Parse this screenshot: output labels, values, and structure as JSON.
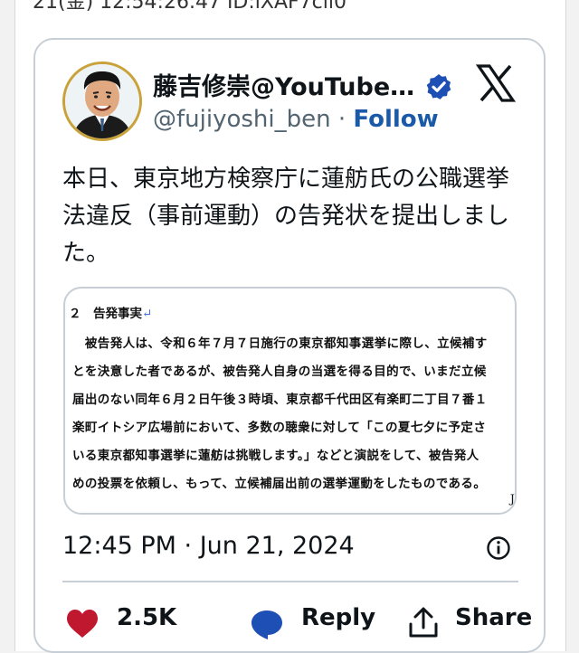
{
  "page": {
    "post_header": "21(金) 12:54:26.47 ID:lXAF7cll0"
  },
  "tweet": {
    "author_name": "藤吉修崇@YouTuber…",
    "handle": "@fujiyoshi_ben",
    "separator": "·",
    "follow_label": "Follow",
    "text": "本日、東京地方検察庁に蓮舫氏の公職選挙法違反（事前運動）の告発状を提出しました。",
    "timestamp": "12:45 PM · Jun 21, 2024",
    "actions": {
      "like_count": "2.5K",
      "reply_label": "Reply",
      "share_label": "Share"
    }
  },
  "document": {
    "heading": "２　告発事実",
    "heading_mark": "↵",
    "lines": [
      "　被告発人は、令和６年７月７日施行の東京都知事選挙に際し、立候補す",
      "とを決意した者であるが、被告発人自身の当選を得る目的で、いまだ立候",
      "届出のない同年６月２日午後３時頃、東京都千代田区有楽町二丁目７番１",
      "楽町イトシア広場前において、多数の聴衆に対して「この夏七夕に予定さ",
      "いる東京都知事選挙に蓮舫は挑戦します。」などと演説をして、被告発人",
      "めの投票を依頼し、もって、立候補届出前の選挙運動をしたものである。"
    ],
    "corner_mark": "J"
  },
  "colors": {
    "accent": "#1b5aa8",
    "verified": "#1d4fb5",
    "like": "#c0182f",
    "reply": "#1d4fb5",
    "border": "#c7ced6"
  },
  "icons": {
    "verified": "verified-badge-icon",
    "x_logo": "x-logo-icon",
    "info": "info-icon",
    "like": "heart-icon",
    "reply": "speech-bubble-icon",
    "share": "share-upload-icon"
  }
}
